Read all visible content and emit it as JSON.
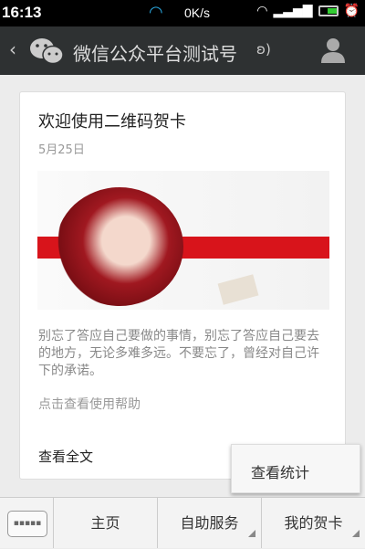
{
  "status": {
    "time": "16:13",
    "speed": "0K/s"
  },
  "nav": {
    "title": "微信公众平台测试号"
  },
  "card": {
    "title": "欢迎使用二维码贺卡",
    "date": "5月25日",
    "description": "别忘了答应自己要做的事情，别忘了答应自己要去的地方，无论多难多远。不要忘了，曾经对自己许下的承诺。",
    "help": "点击查看使用帮助",
    "read_full": "查看全文"
  },
  "popup": {
    "item": "查看统计"
  },
  "menu": {
    "items": [
      {
        "label": "主页"
      },
      {
        "label": "自助服务"
      },
      {
        "label": "我的贺卡"
      }
    ]
  }
}
